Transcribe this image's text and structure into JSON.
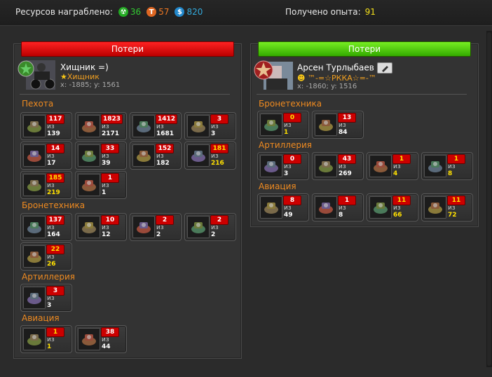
{
  "topbar": {
    "resources_label": "Ресурсов награблено:",
    "res1": "36",
    "res1_color": "#33cc33",
    "res2": "57",
    "res2_color": "#ee7722",
    "res3": "820",
    "res3_color": "#33aadd",
    "exp_label": "Получено опыта:",
    "exp_value": "91"
  },
  "left": {
    "header": "Потери",
    "player": {
      "name": "Хищник =)",
      "clan": "Хищник",
      "coords": "x: -1885; y: 1561"
    },
    "categories": [
      {
        "label": "Пехота",
        "units": [
          {
            "lost": "117",
            "of": "из",
            "total": "139"
          },
          {
            "lost": "1823",
            "of": "из",
            "total": "2171"
          },
          {
            "lost": "1412",
            "of": "из",
            "total": "1681"
          },
          {
            "lost": "3",
            "of": "из",
            "total": "3"
          },
          {
            "lost": "14",
            "of": "из",
            "total": "17"
          },
          {
            "lost": "33",
            "of": "из",
            "total": "39"
          },
          {
            "lost": "152",
            "of": "из",
            "total": "182"
          },
          {
            "lost": "181",
            "of": "из",
            "total": "216",
            "yellow": true
          },
          {
            "lost": "185",
            "of": "из",
            "total": "219",
            "yellow": true
          },
          {
            "lost": "1",
            "of": "из",
            "total": "1"
          }
        ]
      },
      {
        "label": "Бронетехника",
        "units": [
          {
            "lost": "137",
            "of": "из",
            "total": "164"
          },
          {
            "lost": "10",
            "of": "из",
            "total": "12"
          },
          {
            "lost": "2",
            "of": "из",
            "total": "2"
          },
          {
            "lost": "2",
            "of": "из",
            "total": "2"
          },
          {
            "lost": "22",
            "of": "из",
            "total": "26",
            "yellow": true
          }
        ]
      },
      {
        "label": "Артиллерия",
        "units": [
          {
            "lost": "3",
            "of": "из",
            "total": "3"
          }
        ]
      },
      {
        "label": "Авиация",
        "units": [
          {
            "lost": "1",
            "of": "из",
            "total": "1",
            "yellow": true
          },
          {
            "lost": "38",
            "of": "из",
            "total": "44"
          }
        ]
      }
    ]
  },
  "right": {
    "header": "Потери",
    "player": {
      "name": "Арсен Турлыбаев",
      "clan": "™-=☆РККА☆=-™",
      "coords": "x: -1860; y: 1516"
    },
    "categories": [
      {
        "label": "Бронетехника",
        "units": [
          {
            "lost": "0",
            "of": "из",
            "total": "1",
            "yellow": true
          },
          {
            "lost": "13",
            "of": "из",
            "total": "84"
          }
        ]
      },
      {
        "label": "Артиллерия",
        "units": [
          {
            "lost": "0",
            "of": "из",
            "total": "3"
          },
          {
            "lost": "43",
            "of": "из",
            "total": "269"
          },
          {
            "lost": "1",
            "of": "из",
            "total": "4",
            "yellow": true
          },
          {
            "lost": "1",
            "of": "из",
            "total": "8",
            "yellow": true
          }
        ]
      },
      {
        "label": "Авиация",
        "units": [
          {
            "lost": "8",
            "of": "из",
            "total": "49"
          },
          {
            "lost": "1",
            "of": "из",
            "total": "8"
          },
          {
            "lost": "11",
            "of": "из",
            "total": "66",
            "yellow": true
          },
          {
            "lost": "11",
            "of": "из",
            "total": "72",
            "yellow": true
          }
        ]
      }
    ]
  }
}
